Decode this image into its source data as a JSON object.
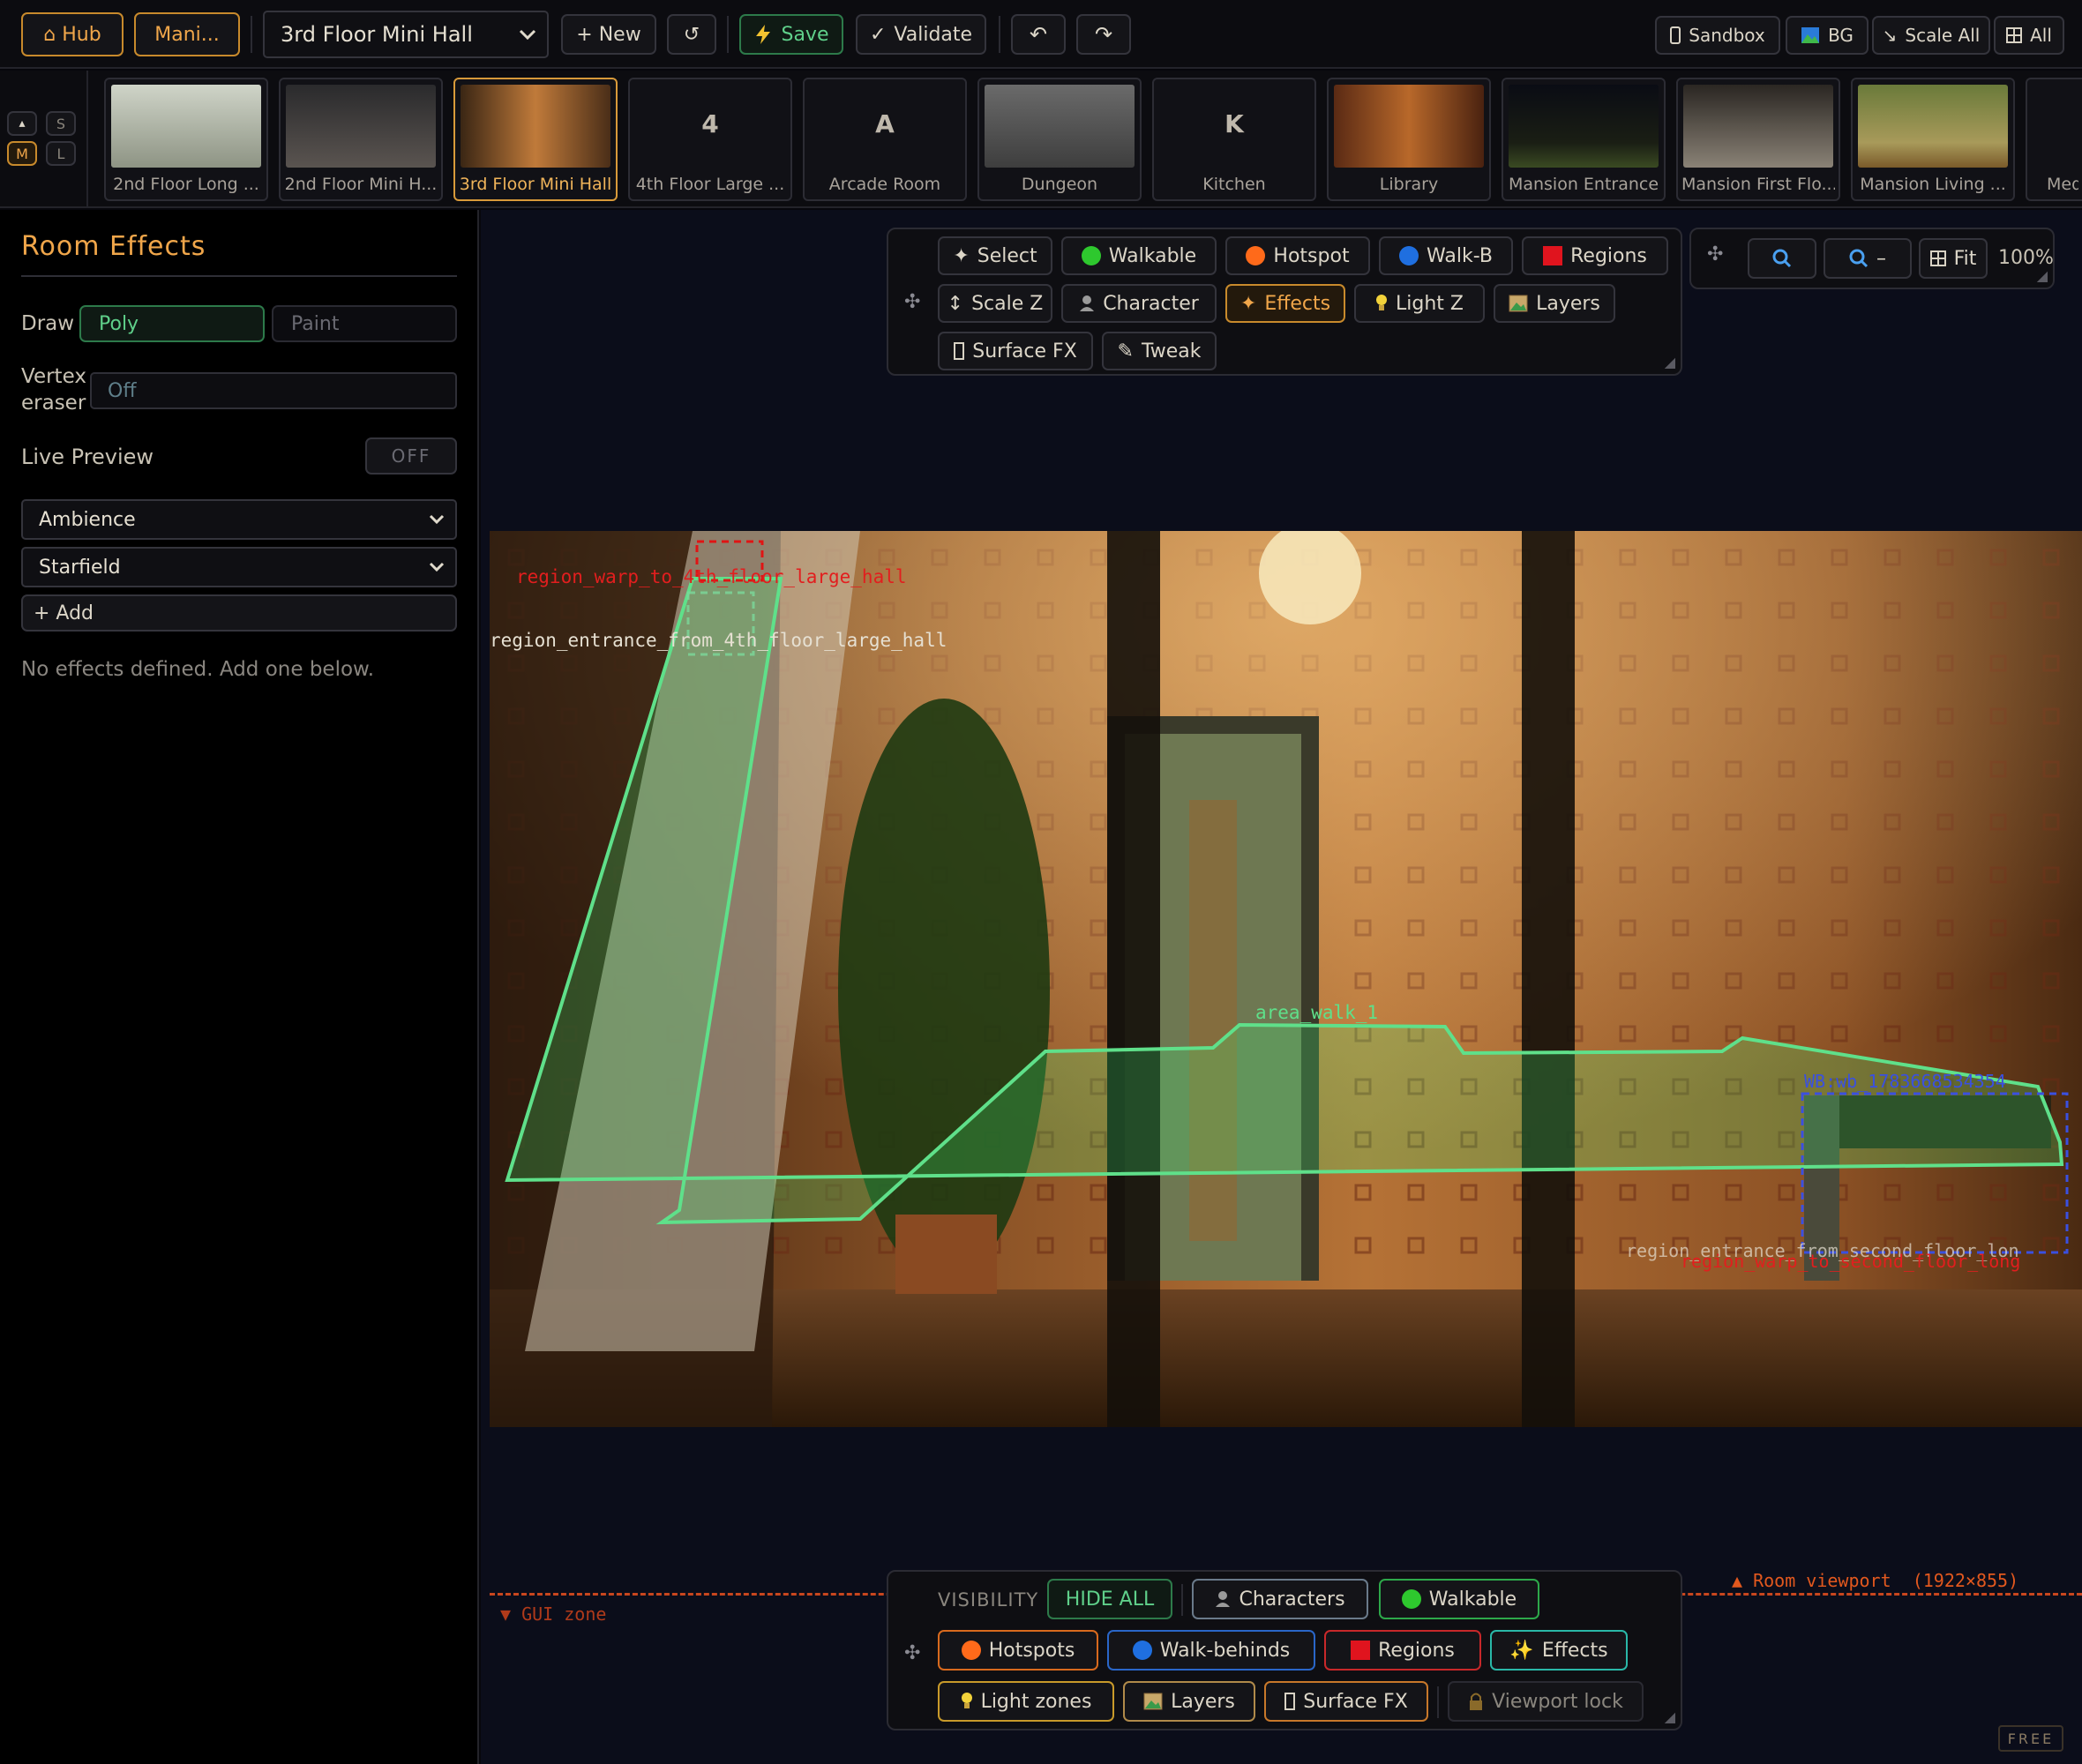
{
  "topbar": {
    "hub": "⌂ Hub",
    "manifest": "Mani...",
    "room_select": "3rd Floor Mini Hall",
    "new": "+ New",
    "reload": "↺",
    "save": "Save",
    "validate": "Validate",
    "undo": "↶",
    "redo": "↷",
    "sandbox": "Sandbox",
    "bg": "BG",
    "scale_all": "Scale All",
    "all": "All"
  },
  "sizes": {
    "up": "▴",
    "s": "S",
    "m": "M",
    "l": "L"
  },
  "rooms": [
    {
      "label": "2nd Floor Long ...",
      "letter": ""
    },
    {
      "label": "2nd Floor Mini H...",
      "letter": ""
    },
    {
      "label": "3rd Floor Mini Hall",
      "letter": ""
    },
    {
      "label": "4th Floor Large ...",
      "letter": "4"
    },
    {
      "label": "Arcade Room",
      "letter": "A"
    },
    {
      "label": "Dungeon",
      "letter": ""
    },
    {
      "label": "Kitchen",
      "letter": "K"
    },
    {
      "label": "Library",
      "letter": ""
    },
    {
      "label": "Mansion Entrance",
      "letter": ""
    },
    {
      "label": "Mansion First Flo...",
      "letter": ""
    },
    {
      "label": "Mansion Living ...",
      "letter": ""
    },
    {
      "label": "Med",
      "letter": ""
    }
  ],
  "sidebar": {
    "title": "Room Effects",
    "draw_label": "Draw",
    "poly": "Poly",
    "paint": "Paint",
    "vertex_label_1": "Vertex",
    "vertex_label_2": "eraser",
    "vertex_value": "Off",
    "live_preview": "Live Preview",
    "live_toggle": "OFF",
    "category": "Ambience",
    "effect": "Starfield",
    "add": "+ Add",
    "empty": "No effects defined. Add one below."
  },
  "tools": {
    "select": "Select",
    "walkable": "Walkable",
    "hotspot": "Hotspot",
    "walkb": "Walk-B",
    "regions": "Regions",
    "scalez": "Scale Z",
    "character": "Character",
    "effects": "Effects",
    "lightz": "Light Z",
    "layers": "Layers",
    "surfacefx": "Surface FX",
    "tweak": "Tweak"
  },
  "zoom": {
    "fit": "Fit",
    "level": "100%"
  },
  "scene": {
    "region_warp": "region_warp_to_4th_floor_large_hall",
    "region_entrance": "region_entrance_from_4th_floor_large_hall",
    "area_walk": "area_walk_1",
    "wb": "WB:wb_1783668534354",
    "region_entrance_right": "region_entrance_from_second_floor_lon",
    "region_warp_right": "region_warp_to_second_floor_long"
  },
  "viewport": {
    "room_viewport": "▲ Room viewport  (1922×855)",
    "gui_zone": "▼ GUI zone"
  },
  "visibility": {
    "label": "VISIBILITY",
    "hide_all": "HIDE ALL",
    "characters": "Characters",
    "walkable": "Walkable",
    "hotspots": "Hotspots",
    "walkbehinds": "Walk-behinds",
    "regions": "Regions",
    "effects": "Effects",
    "lightzones": "Light zones",
    "layers": "Layers",
    "surfacefx": "Surface FX",
    "viewportlock": "Viewport lock"
  },
  "footer": {
    "free": "FREE"
  },
  "colors": {
    "accent_orange": "#f0a64a",
    "walkable_green": "#5fe08a",
    "hotspot_orange": "#ff6a1a",
    "walkb_blue": "#1f6fe0",
    "region_red": "#e0141e"
  }
}
